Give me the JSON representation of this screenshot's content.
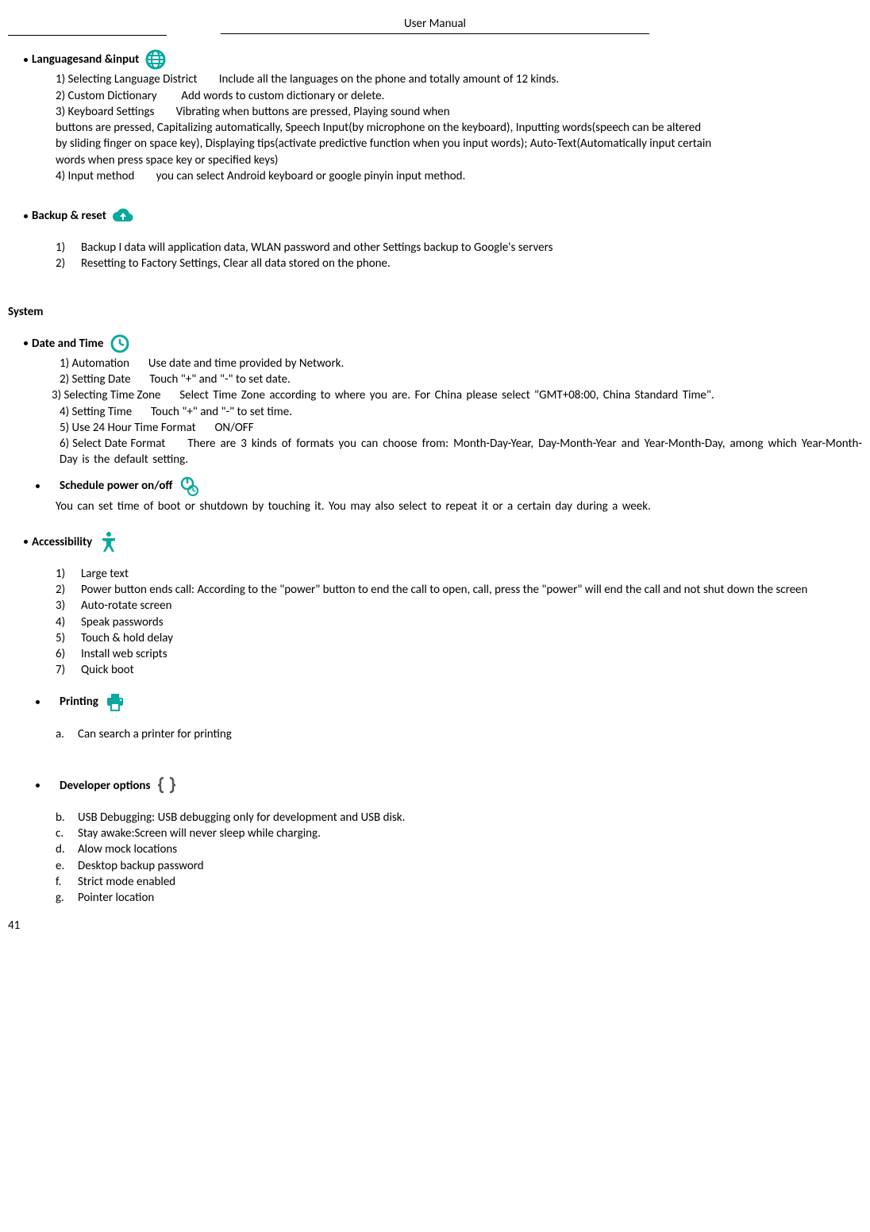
{
  "header": "User    Manual",
  "pageNum": "41",
  "lang": {
    "title": "Languagesand &input",
    "l1a": "1) Selecting Language District",
    "l1b": "Include all the languages on the phone and totally amount of 12 kinds.",
    "l2a": "2) Custom Dictionary",
    "l2b": "Add words to custom dictionary or delete.",
    "l3a": "3) Keyboard Settings",
    "l3b": "Vibrating when buttons are pressed, Playing sound when",
    "l3c": "buttons are pressed, Capitalizing automatically, Speech Input(by microphone on the keyboard), Inputting words(speech can be altered by sliding finger on space key), Displaying tips(activate predictive function when you input words); Auto-Text(Automatically input certain words when press space key or specified keys)",
    "l4a": "4) Input method",
    "l4b": "you can select Android keyboard or google pinyin input method."
  },
  "backup": {
    "title": "Backup & reset",
    "l1": "Backup I data will application data, WLAN password and other Settings backup to Google's servers",
    "l2": "Resetting to Factory Settings, Clear all data stored on the phone."
  },
  "systemTitle": "System",
  "datetime": {
    "title": "Date and Time",
    "l1a": "1) Automation",
    "l1b": "Use date and time provided by Network.",
    "l2a": "2) Setting Date",
    "l2b": "Touch \"+\" and \"-\" to set date.",
    "l3a": "3) Selecting Time Zone",
    "l3b": "Select Time Zone according to where you are. For China please select \"GMT+08:00, China Standard Time\".",
    "l4a": "4) Setting Time",
    "l4b": "Touch \"+\" and \"-\" to set time.",
    "l5a": "5) Use 24 Hour Time Format",
    "l5b": "ON/OFF",
    "l6a": "6) Select Date Format",
    "l6b": "There are 3 kinds of formats you can choose from: Month-Day-Year, Day-Month-Year and Year-Month-Day, among which Year-Month-Day is the default setting."
  },
  "schedule": {
    "title": "Schedule power on/off",
    "body": "You can set time of boot or shutdown by touching it. You may also select to repeat it or a certain day during a week."
  },
  "access": {
    "title": "Accessibility",
    "l1": "Large text",
    "l2a": "Power button ends call: ",
    "l2b": "According to the \"power\" button to end the call to open, call, press the \"power\" will end the call and not shut down the screen",
    "l3": "Auto-rotate screen",
    "l4": "Speak passwords",
    "l5": "Touch & hold delay",
    "l6": "Install web scripts",
    "l7": "Quick boot"
  },
  "printing": {
    "title": "Printing",
    "a": "Can search a printer for printing"
  },
  "dev": {
    "title": "Developer    options",
    "b1": "USB Debugging: ",
    "b2": "USB debugging only for development and USB disk.",
    "c": "Stay awake:Screen will never sleep while charging.",
    "d": "Alow mock locations",
    "e": "Desktop backup password",
    "f": "Strict mode enabled",
    "g": "Pointer location"
  }
}
